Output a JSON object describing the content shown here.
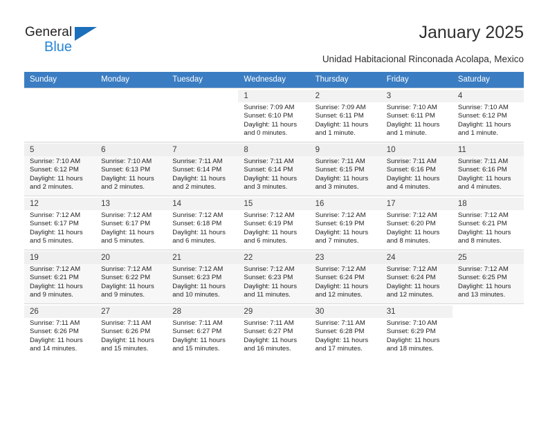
{
  "brand": {
    "name_top": "General",
    "name_bottom": "Blue",
    "triangle_color": "#1c6fba",
    "blue_color": "#2585d3"
  },
  "header": {
    "title": "January 2025",
    "subtitle": "Unidad Habitacional Rinconada Acolapa, Mexico"
  },
  "colors": {
    "header_row_bg": "#3b7dc2",
    "header_row_text": "#ffffff",
    "alt_row_bg": "#f7f7f7",
    "cell_border": "#d9d9d9"
  },
  "weekdays": [
    "Sunday",
    "Monday",
    "Tuesday",
    "Wednesday",
    "Thursday",
    "Friday",
    "Saturday"
  ],
  "weeks": [
    [
      {
        "day": "",
        "sunrise": "",
        "sunset": "",
        "daylight": "",
        "empty": true
      },
      {
        "day": "",
        "sunrise": "",
        "sunset": "",
        "daylight": "",
        "empty": true
      },
      {
        "day": "",
        "sunrise": "",
        "sunset": "",
        "daylight": "",
        "empty": true
      },
      {
        "day": "1",
        "sunrise": "Sunrise: 7:09 AM",
        "sunset": "Sunset: 6:10 PM",
        "daylight": "Daylight: 11 hours and 0 minutes."
      },
      {
        "day": "2",
        "sunrise": "Sunrise: 7:09 AM",
        "sunset": "Sunset: 6:11 PM",
        "daylight": "Daylight: 11 hours and 1 minute."
      },
      {
        "day": "3",
        "sunrise": "Sunrise: 7:10 AM",
        "sunset": "Sunset: 6:11 PM",
        "daylight": "Daylight: 11 hours and 1 minute."
      },
      {
        "day": "4",
        "sunrise": "Sunrise: 7:10 AM",
        "sunset": "Sunset: 6:12 PM",
        "daylight": "Daylight: 11 hours and 1 minute."
      }
    ],
    [
      {
        "day": "5",
        "sunrise": "Sunrise: 7:10 AM",
        "sunset": "Sunset: 6:12 PM",
        "daylight": "Daylight: 11 hours and 2 minutes."
      },
      {
        "day": "6",
        "sunrise": "Sunrise: 7:10 AM",
        "sunset": "Sunset: 6:13 PM",
        "daylight": "Daylight: 11 hours and 2 minutes."
      },
      {
        "day": "7",
        "sunrise": "Sunrise: 7:11 AM",
        "sunset": "Sunset: 6:14 PM",
        "daylight": "Daylight: 11 hours and 2 minutes."
      },
      {
        "day": "8",
        "sunrise": "Sunrise: 7:11 AM",
        "sunset": "Sunset: 6:14 PM",
        "daylight": "Daylight: 11 hours and 3 minutes."
      },
      {
        "day": "9",
        "sunrise": "Sunrise: 7:11 AM",
        "sunset": "Sunset: 6:15 PM",
        "daylight": "Daylight: 11 hours and 3 minutes."
      },
      {
        "day": "10",
        "sunrise": "Sunrise: 7:11 AM",
        "sunset": "Sunset: 6:16 PM",
        "daylight": "Daylight: 11 hours and 4 minutes."
      },
      {
        "day": "11",
        "sunrise": "Sunrise: 7:11 AM",
        "sunset": "Sunset: 6:16 PM",
        "daylight": "Daylight: 11 hours and 4 minutes."
      }
    ],
    [
      {
        "day": "12",
        "sunrise": "Sunrise: 7:12 AM",
        "sunset": "Sunset: 6:17 PM",
        "daylight": "Daylight: 11 hours and 5 minutes."
      },
      {
        "day": "13",
        "sunrise": "Sunrise: 7:12 AM",
        "sunset": "Sunset: 6:17 PM",
        "daylight": "Daylight: 11 hours and 5 minutes."
      },
      {
        "day": "14",
        "sunrise": "Sunrise: 7:12 AM",
        "sunset": "Sunset: 6:18 PM",
        "daylight": "Daylight: 11 hours and 6 minutes."
      },
      {
        "day": "15",
        "sunrise": "Sunrise: 7:12 AM",
        "sunset": "Sunset: 6:19 PM",
        "daylight": "Daylight: 11 hours and 6 minutes."
      },
      {
        "day": "16",
        "sunrise": "Sunrise: 7:12 AM",
        "sunset": "Sunset: 6:19 PM",
        "daylight": "Daylight: 11 hours and 7 minutes."
      },
      {
        "day": "17",
        "sunrise": "Sunrise: 7:12 AM",
        "sunset": "Sunset: 6:20 PM",
        "daylight": "Daylight: 11 hours and 8 minutes."
      },
      {
        "day": "18",
        "sunrise": "Sunrise: 7:12 AM",
        "sunset": "Sunset: 6:21 PM",
        "daylight": "Daylight: 11 hours and 8 minutes."
      }
    ],
    [
      {
        "day": "19",
        "sunrise": "Sunrise: 7:12 AM",
        "sunset": "Sunset: 6:21 PM",
        "daylight": "Daylight: 11 hours and 9 minutes."
      },
      {
        "day": "20",
        "sunrise": "Sunrise: 7:12 AM",
        "sunset": "Sunset: 6:22 PM",
        "daylight": "Daylight: 11 hours and 9 minutes."
      },
      {
        "day": "21",
        "sunrise": "Sunrise: 7:12 AM",
        "sunset": "Sunset: 6:23 PM",
        "daylight": "Daylight: 11 hours and 10 minutes."
      },
      {
        "day": "22",
        "sunrise": "Sunrise: 7:12 AM",
        "sunset": "Sunset: 6:23 PM",
        "daylight": "Daylight: 11 hours and 11 minutes."
      },
      {
        "day": "23",
        "sunrise": "Sunrise: 7:12 AM",
        "sunset": "Sunset: 6:24 PM",
        "daylight": "Daylight: 11 hours and 12 minutes."
      },
      {
        "day": "24",
        "sunrise": "Sunrise: 7:12 AM",
        "sunset": "Sunset: 6:24 PM",
        "daylight": "Daylight: 11 hours and 12 minutes."
      },
      {
        "day": "25",
        "sunrise": "Sunrise: 7:12 AM",
        "sunset": "Sunset: 6:25 PM",
        "daylight": "Daylight: 11 hours and 13 minutes."
      }
    ],
    [
      {
        "day": "26",
        "sunrise": "Sunrise: 7:11 AM",
        "sunset": "Sunset: 6:26 PM",
        "daylight": "Daylight: 11 hours and 14 minutes."
      },
      {
        "day": "27",
        "sunrise": "Sunrise: 7:11 AM",
        "sunset": "Sunset: 6:26 PM",
        "daylight": "Daylight: 11 hours and 15 minutes."
      },
      {
        "day": "28",
        "sunrise": "Sunrise: 7:11 AM",
        "sunset": "Sunset: 6:27 PM",
        "daylight": "Daylight: 11 hours and 15 minutes."
      },
      {
        "day": "29",
        "sunrise": "Sunrise: 7:11 AM",
        "sunset": "Sunset: 6:27 PM",
        "daylight": "Daylight: 11 hours and 16 minutes."
      },
      {
        "day": "30",
        "sunrise": "Sunrise: 7:11 AM",
        "sunset": "Sunset: 6:28 PM",
        "daylight": "Daylight: 11 hours and 17 minutes."
      },
      {
        "day": "31",
        "sunrise": "Sunrise: 7:10 AM",
        "sunset": "Sunset: 6:29 PM",
        "daylight": "Daylight: 11 hours and 18 minutes."
      },
      {
        "day": "",
        "sunrise": "",
        "sunset": "",
        "daylight": "",
        "empty": true
      }
    ]
  ]
}
